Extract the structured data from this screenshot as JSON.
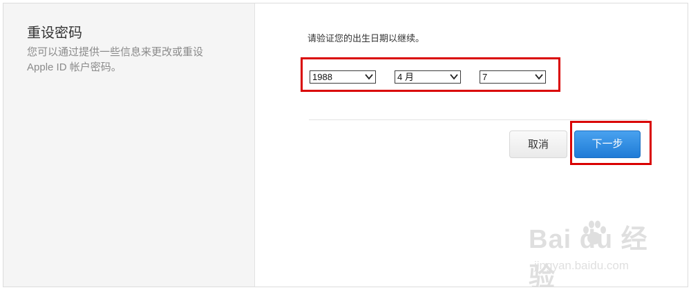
{
  "sidebar": {
    "title": "重设密码",
    "description": "您可以通过提供一些信息来更改或重设 Apple ID 帐户密码。"
  },
  "form": {
    "prompt": "请验证您的出生日期以继续。",
    "year": "1988",
    "month": "4 月",
    "day": "7"
  },
  "actions": {
    "cancel_label": "取消",
    "next_label": "下一步"
  },
  "watermark": {
    "logo_text": "Bai  du 经验",
    "url": "jingyan.baidu.com"
  },
  "colors": {
    "highlight": "#d90000",
    "primary_button": "#2a8ae3"
  },
  "icons": {
    "dropdown": "chevron-down-icon",
    "watermark_logo": "paw-icon"
  }
}
